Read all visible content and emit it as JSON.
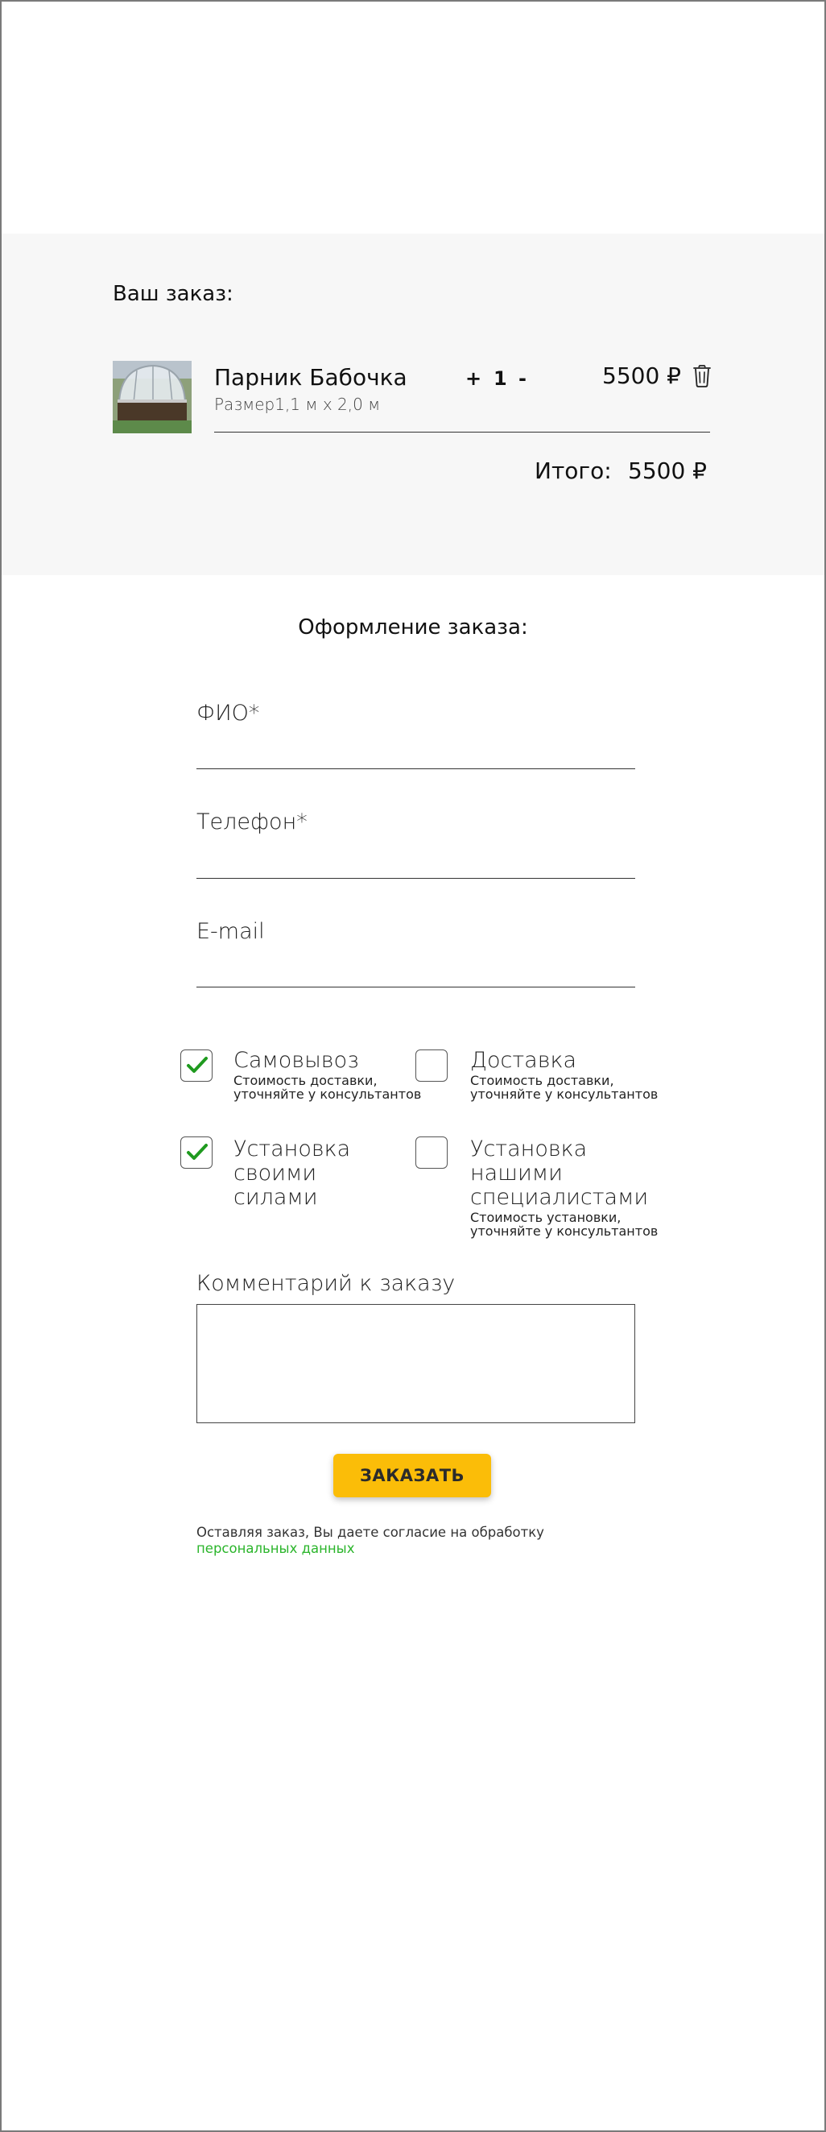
{
  "order": {
    "title": "Ваш заказ:",
    "item": {
      "name": "Парник Бабочка",
      "size": "Размер1,1 м х 2,0 м",
      "qty_plus": "+",
      "qty": "1",
      "qty_minus": "-",
      "price": "5500 ₽",
      "image_icon": "greenhouse-photo",
      "delete_icon": "trash-icon"
    },
    "total_label": "Итого:",
    "total_value": "5500 ₽"
  },
  "checkout": {
    "title": "Оформление заказа:",
    "fields": {
      "name_label": "ФИО*",
      "phone_label": "Телефон*",
      "email_label": "E-mail"
    },
    "options": {
      "pickup": {
        "label": "Самовывоз",
        "sub1": "Стоимость доставки,",
        "sub2": "уточняйте у консультантов",
        "checked": true
      },
      "delivery": {
        "label": "Доставка",
        "sub1": "Стоимость доставки,",
        "sub2": "уточняйте у консультантов",
        "checked": false
      },
      "self_install": {
        "label1": "Установка",
        "label2": "своими",
        "label3": "силами",
        "checked": true
      },
      "pro_install": {
        "label1": "Установка",
        "label2": "нашими",
        "label3": "специалистами",
        "sub1": "Стоимость установки,",
        "sub2": "уточняйте у консультантов",
        "checked": false
      }
    },
    "comment_label": "Комментарий к заказу",
    "submit_label": "ЗАКАЗАТЬ",
    "consent_text": "Оставляя заказ, Вы даете согласие на обработку",
    "consent_link": "персональных данных"
  },
  "colors": {
    "accent": "#fbbd08",
    "check": "#1f9a1f",
    "link": "#2bb52b",
    "summary_bg": "#f7f7f7"
  }
}
